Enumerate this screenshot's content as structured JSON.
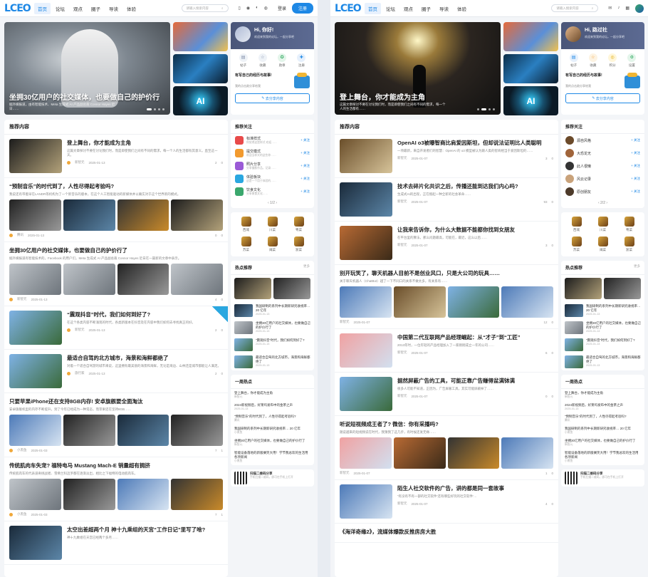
{
  "left": {
    "logo": "LCEO",
    "nav": [
      "首页",
      "论坛",
      "观点",
      "圈子",
      "导读",
      "体验"
    ],
    "search_placeholder": "请输入搜索内容",
    "login": "登录",
    "register": "注册",
    "hero": {
      "title": "坐拥30亿用户的社交媒体，也要做自己的护价行",
      "desc": "据外媒报道，由有智能技术、Meta 生成式 AI 产品副总裁 Connor Hayes 近日……"
    },
    "user_card": {
      "hello": "Hi, 你好!",
      "sub": "欢迎来到我的论坛，一起分享吧",
      "icons": [
        "帖子",
        "收藏",
        "勋章",
        "注册"
      ],
      "promo_title": "有写自己的经历与故事!",
      "promo_sub": "我的点击勋分享给我",
      "share_button": "去分享内容"
    },
    "thumb_ai_label": "AI",
    "section_title": "推荐内容",
    "posts": [
      {
        "title": "登上舞台，你才能成为主角",
        "excerpt": "这篇文章探讨不要在讨论我们时，而是即使我们之间有不同的需求，每一个人的生活都有其意义。直至这一天。",
        "author": "新智元",
        "date": "2025-01-13",
        "views": "2",
        "comments": "0"
      },
      {
        "title": "“预制音乐”的时代到了，人性尽得起考验吗?",
        "excerpt": "我说还有带着早在LANDR等机构为了一个新音乐的版本，在这个人工智能驱动的新媒体并以确实对于这个世界新的模式。",
        "author": "腾讯",
        "date": "2025-01-13",
        "views": "0",
        "comments": "0"
      },
      {
        "title": "坐拥30亿用户的社交媒体，也要做自己的护价行了",
        "excerpt": "据外媒报道有智能技术的，Facebook 的用户们，Meta 生成式 AI 产品副总裁 Connor Hayes 近日在一篇新的文章中表示。",
        "author": "新智元",
        "date": "2025-01-13",
        "views": "4",
        "comments": "0"
      },
      {
        "title": "“震观抖音”时代，我们如何到好了?",
        "excerpt": "在这个各类内容不断涌现的时代，各类新版本在抖音及在内容中我们如何去寻找真正的好。",
        "author": "新智元",
        "date": "2025-01-13",
        "views": "2",
        "comments": "0"
      },
      {
        "title": "最适合自驾的北方城市，海景和海鲜都绝了",
        "excerpt": "对着一个适合自驾游的城市来说，这里拥有最美丽的海景和海鲜，无论是海边、山林还是城市都能让人满足。",
        "author": "旅行家",
        "date": "2025-01-13",
        "views": "2",
        "comments": "0"
      },
      {
        "title": "只要苹果iPhone还在支持8GB内存! 安卓旗舰要全面淘汰",
        "excerpt": "安卓旗舰机型的内存不断提升，到了今年已经成为一种常态，而苹果还在坚持8GB……",
        "author": "小黑鱼",
        "date": "2025-01-03",
        "views": "7",
        "comments": "1"
      },
      {
        "title": "传统肌肉车失宠? 福特电马 Mustang Mach-E 销量超有拥挤",
        "excerpt": "传统肌肉车的代表道奇挑战者、雪佛兰科迈罗都在逐渐淡出，相比之下福特的电动肌肉车。",
        "author": "小黑鱼",
        "date": "2025-01-03",
        "views": "7",
        "comments": "1"
      },
      {
        "title": "太空出差超两个月 神十九乘组的天宫“工作日记”里写了啥?",
        "excerpt": "神十九乘组在天宫已经两个多月……",
        "author": "",
        "date": "",
        "views": "",
        "comments": ""
      }
    ],
    "follow_title": "推荐关注",
    "follows": [
      {
        "name": "标准样式",
        "sub": "你觉得这是样式 欢迎……",
        "btn": "+ 关注"
      },
      {
        "name": "提交模式",
        "sub": "欢迎当样式的这些你……",
        "btn": "+ 关注"
      },
      {
        "name": "照片分享",
        "sub": "分享摄影作品，记录……",
        "btn": "+ 关注"
      },
      {
        "name": "体验板块",
        "sub": "这是一个用于体验的……",
        "btn": "+ 关注"
      },
      {
        "name": "饮食文化",
        "sub": "分享美食文化……",
        "btn": "+ 关注"
      }
    ],
    "pager": "‹  1/2  ›",
    "medals": [
      "西城",
      "川菜",
      "粤菜",
      "苏菜",
      "闽菜",
      "浙菜"
    ],
    "hot_title": "热点推荐",
    "hot_more": "更多",
    "hot_items": [
      {
        "text": "我国研制的系列中长期新研究收视率… 20 亿年",
        "date": "2025-01-13"
      },
      {
        "text": "坐拥30亿用户的社交媒体，也要做自己的护价行了",
        "date": "2025-01-13"
      },
      {
        "text": "“震观抖音”时代，我们如何到好了?",
        "date": "2025-01-13"
      },
      {
        "text": "最适合自驾的北方城市，海景和海鲜都绝了",
        "date": "2025-01-13"
      }
    ],
    "week_title": "一周热点",
    "week_items": [
      {
        "text": "登上舞台，你才能成为主角",
        "author": "新智元"
      },
      {
        "text": "2024新视频后，好莱坞发布中的金茶之声",
        "author": "",
        "date": "2025-01-13"
      },
      {
        "text": "“预制音乐”的时代到了，人性尽得起考验吗?",
        "author": "腾讯"
      },
      {
        "text": "我国研制的系列中长期新研究收视率… 20 亿年",
        "author": "小黑鱼"
      },
      {
        "text": "坐拥30亿用户的社交媒体，也要做自己的护价行了",
        "author": "新智元"
      },
      {
        "text": "智能设备落地的新版搁笑大用！学节我总欢的生活用各项新闻",
        "author": "小黑鱼"
      }
    ],
    "qr_title": "扫描二维码分享",
    "qr_sub": "手机扫描二维码，即可在手机上打开"
  },
  "right": {
    "hero": {
      "title": "登上舞台，你才能成为主角",
      "desc": "这篇文章探讨不要在讨论我们时，而是即使我们之间有不同的需求，每一个人的生活都有……"
    },
    "user_card": {
      "hello": "Hi, 路过社",
      "sub": "欢迎来到我的论坛，一起分享吧",
      "icons": [
        "帖子",
        "收藏",
        "积分",
        "设置"
      ],
      "promo_title": "有写自己的经历与故事!",
      "promo_sub": "我的点击勋分享给我",
      "share_button": "去分享内容"
    },
    "posts": [
      {
        "title": "OpenAI o3被曝智商比肩爱因斯坦，但却说法证明比人类聪明",
        "excerpt": "一项最新，来自开发者们的智慧：OpenAI 的 o3 模型被认为跟人类的智商相当于爱因斯坦的……",
        "author": "新智元",
        "date": "2025-01-07",
        "views": "3",
        "comments": "0"
      },
      {
        "title": "技术去碎片化共识之后，传播还能到达我们内心吗?",
        "excerpt": "生成式AI的出现，正在掀起一种全新的社会革命……",
        "author": "新智元",
        "date": "2025-01-07",
        "views": "93",
        "comments": "0"
      },
      {
        "title": "让我来告诉你，为什么大数据不能都你找到女朋友",
        "excerpt": "在平台里的算法，那么问题最高，可能在，最近，这么以后……",
        "author": "新智元",
        "date": "2025-01-07",
        "views": "3",
        "comments": "0"
      },
      {
        "title": "别开玩笑了，聊天机器人目前不是创业风口，只是大公司的玩具……",
        "excerpt": "关于聊天机器人（ChatBot）越了一下不同口的关系不做太多，有关系有……",
        "author": "新智元",
        "date": "2025-01-07",
        "views": "12",
        "comments": "0"
      },
      {
        "title": "中国第二代互联网产品经理崛起：从“才子”到“工匠”",
        "excerpt": "2013年时，一位年轻的产品经理加入了一家刚刚成立一年的公司……",
        "author": "新智元",
        "date": "2025-01-07",
        "views": "6",
        "comments": "0"
      },
      {
        "title": "据然屏蔽广告的工具，可能正靠广告赚得盆满钵满",
        "excerpt": "很多人可能不知道，正因为，广告屏蔽工具，其实可能屏蔽掉了……",
        "author": "新智元",
        "date": "2025-01-07",
        "views": "0",
        "comments": "0"
      },
      {
        "title": "听说短视频成王者了? 微信：你有采播吗?",
        "excerpt": "随说越来的短视频说在时代，我猜我了这几乎，有时候还发无缘……",
        "author": "新智元",
        "date": "2025-01-07",
        "views": "1",
        "comments": "0"
      },
      {
        "title": "陌生人社交软件的广告，讲的都是同一套故事",
        "excerpt": "“有没有不有一部的社交软件‘还有哪些好玩的社交软件’…",
        "author": "新智元",
        "date": "2025-01-07",
        "views": "4",
        "comments": "0"
      },
      {
        "title": "《海洋奇缘2》，流媒体爆款反推房房大胜",
        "excerpt": "",
        "author": "",
        "date": "",
        "views": "",
        "comments": ""
      }
    ],
    "follows": [
      {
        "name": "源自风格",
        "btn": "+ 关注"
      },
      {
        "name": "大恐龙无",
        "btn": "+ 关注"
      },
      {
        "name": "此人很懒",
        "btn": "+ 关注"
      },
      {
        "name": "风云记录",
        "btn": "+ 关注"
      },
      {
        "name": "原创朋友",
        "btn": "+ 关注"
      }
    ],
    "pager": "‹  2/2  ›",
    "medals": [
      "西城",
      "川菜",
      "粤菜",
      "苏菜",
      "闽菜",
      "浙菜"
    ],
    "hot_items": [
      {
        "text": "我国研制的系列中长期新研究收视率… 20 亿年",
        "date": "2025-01-13"
      },
      {
        "text": "坐拥30亿用户的社交媒体，也要做自己的护价行了",
        "date": "2025-01-13"
      },
      {
        "text": "“震观抖音”时代，我们如何到好了?",
        "date": "2025-01-13"
      },
      {
        "text": "最适合自驾的北方城市，海景和海鲜都绝了",
        "date": "2025-01-13"
      }
    ],
    "week_items": [
      {
        "text": "登上舞台，你才能成为主角",
        "author": "新智元"
      },
      {
        "text": "2024新视频后，好莱坞发布中的金茶之声",
        "author": "",
        "date": "2025-01-13"
      },
      {
        "text": "“预制音乐”的时代到了，人性尽得起考验吗?",
        "author": "腾讯"
      },
      {
        "text": "我国研制的系列中长期新研究收视率… 20 亿年",
        "author": "小黑鱼"
      },
      {
        "text": "坐拥30亿用户的社交媒体，也要做自己的护价行了",
        "author": "新智元"
      },
      {
        "text": "智能设备落地的新版搁笑大用！学节我总欢的生活用各项新闻",
        "author": "小黑鱼"
      }
    ]
  },
  "colors": {
    "accent": "#1e88e5",
    "header_card": "#4a5679",
    "bg": "#f3f5f8"
  }
}
